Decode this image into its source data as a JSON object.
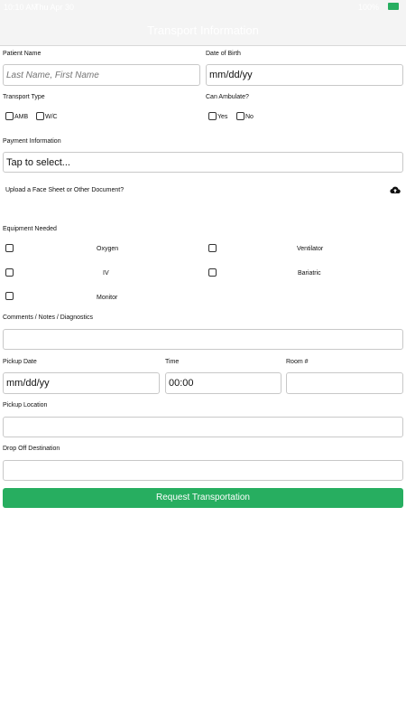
{
  "status_bar": {
    "time": "10:10 AM",
    "date": "Thu Apr 30",
    "signal": "100%"
  },
  "nav": {
    "title": "Transport Information"
  },
  "form": {
    "patient_name": {
      "label": "Patient Name",
      "placeholder": "Last Name, First Name"
    },
    "dob": {
      "label": "Date of Birth",
      "value": "mm/dd/yy"
    },
    "transport_type": {
      "label": "Transport Type",
      "options": [
        "AMB",
        "W/C"
      ]
    },
    "can_ambulate": {
      "label": "Can Ambulate?",
      "options": [
        "Yes",
        "No"
      ]
    },
    "payment": {
      "label": "Payment Information",
      "value": "Tap to select..."
    },
    "upload": {
      "label": "Upload a Face Sheet or Other Document?",
      "icon": "cloud-upload-icon"
    },
    "equipment": {
      "label": "Equipment Needed",
      "items": [
        "Oxygen",
        "Ventilator",
        "IV",
        "Bariatric",
        "Monitor"
      ]
    },
    "comments": {
      "label": "Comments / Notes / Diagnostics",
      "value": ""
    },
    "pickup_date": {
      "label": "Pickup Date",
      "value": "mm/dd/yy"
    },
    "time": {
      "label": "Time",
      "value": "00:00"
    },
    "room": {
      "label": "Room #",
      "value": ""
    },
    "pickup_location": {
      "label": "Pickup Location",
      "value": ""
    },
    "dropoff": {
      "label": "Drop Off Destination",
      "value": ""
    },
    "submit_label": "Request Transportation"
  },
  "colors": {
    "accent": "#27ae60",
    "battery": "#27ae60"
  }
}
